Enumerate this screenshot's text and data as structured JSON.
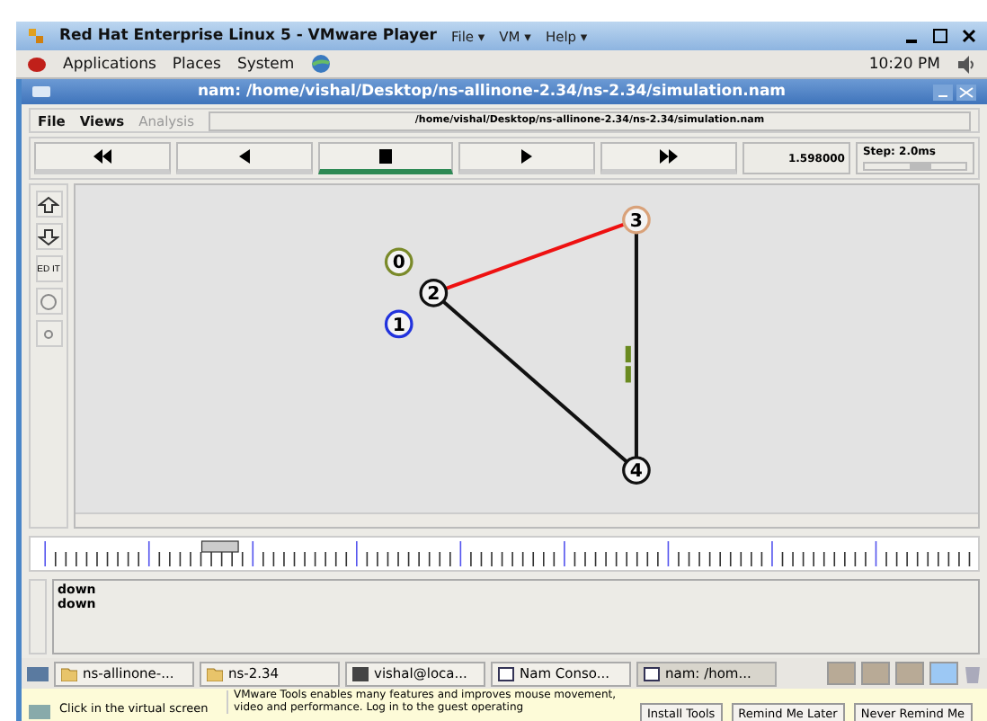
{
  "vm_window": {
    "title": "Red Hat Enterprise Linux 5 - VMware Player",
    "menus": [
      "File ▾",
      "VM ▾",
      "Help ▾"
    ]
  },
  "panel": {
    "menus": [
      "Applications",
      "Places",
      "System"
    ],
    "clock": "10:20 PM"
  },
  "nam_window": {
    "title": "nam: /home/vishal/Desktop/ns-allinone-2.34/ns-2.34/simulation.nam"
  },
  "menu_bar": [
    {
      "label": "File",
      "disabled": false
    },
    {
      "label": "Views",
      "disabled": false
    },
    {
      "label": "Analysis",
      "disabled": true
    }
  ],
  "file_path": "/home/vishal/Desktop/ns-allinone-2.34/ns-2.34/simulation.nam",
  "controls": [
    {
      "kind": "rewind",
      "selected": false
    },
    {
      "kind": "back",
      "selected": false
    },
    {
      "kind": "stop",
      "selected": true
    },
    {
      "kind": "play",
      "selected": false
    },
    {
      "kind": "forward",
      "selected": false
    }
  ],
  "time": "1.598000",
  "step": {
    "label": "Step: 2.0ms",
    "level": 0.55
  },
  "tools": [
    {
      "kind": "zoom-in"
    },
    {
      "kind": "zoom-out"
    },
    {
      "kind": "edit",
      "label": "ED IT"
    },
    {
      "kind": "big-circle"
    },
    {
      "kind": "small-circle"
    }
  ],
  "nodes": [
    {
      "label": "0",
      "color": "#7a8a2a"
    },
    {
      "label": "1",
      "color": "#2233dd"
    },
    {
      "label": "2",
      "color": "#111111"
    },
    {
      "label": "3",
      "color": "#d9a27a"
    },
    {
      "label": "4",
      "color": "#111111"
    }
  ],
  "links": [
    {
      "color": "#ee1111"
    },
    {
      "color": "#111111"
    },
    {
      "color": "#111111"
    }
  ],
  "timeline": {
    "level": 0.2
  },
  "log": [
    "down",
    "down"
  ],
  "taskbar": [
    {
      "label": "ns-allinone-...",
      "kind": "folder",
      "selected": false
    },
    {
      "label": "ns-2.34",
      "kind": "folder",
      "selected": false
    },
    {
      "label": "vishal@loca...",
      "kind": "terminal",
      "selected": false
    },
    {
      "label": "Nam Conso...",
      "kind": "window",
      "selected": false
    },
    {
      "label": "nam: /hom...",
      "kind": "window",
      "selected": true
    }
  ],
  "workspaces": [
    {
      "selected": false
    },
    {
      "selected": false
    },
    {
      "selected": false
    },
    {
      "selected": true
    }
  ],
  "notice": {
    "hint": "Click in the virtual screen",
    "message": "VMware Tools enables many features and improves mouse movement, video and performance. Log in to the guest operating",
    "buttons": [
      "Install Tools",
      "Remind Me Later",
      "Never Remind Me"
    ]
  }
}
